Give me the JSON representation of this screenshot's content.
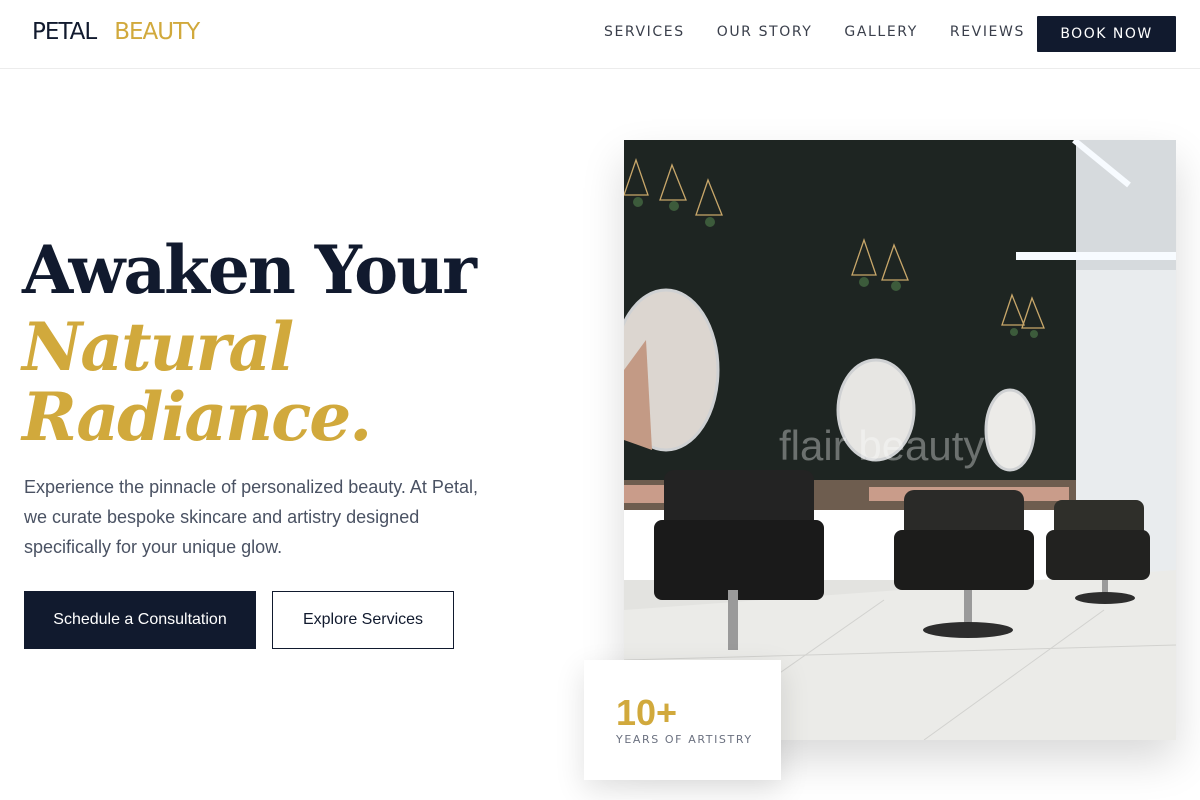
{
  "brand": {
    "word1": "PETAL",
    "word2": "BEAUTY"
  },
  "nav": {
    "items": [
      "SERVICES",
      "OUR STORY",
      "GALLERY",
      "REVIEWS"
    ],
    "cta": "BOOK NOW"
  },
  "hero": {
    "line1": "Awaken Your",
    "line2": "Natural",
    "line3": "Radiance.",
    "description": "Experience the pinnacle of personalized beauty. At Petal, we curate bespoke skincare and artistry designed specifically for your unique glow.",
    "primary_button": "Schedule a Consultation",
    "secondary_button": "Explore Services"
  },
  "photo": {
    "watermark": "flair beauty"
  },
  "stat": {
    "value": "10+",
    "label": "YEARS OF ARTISTRY"
  },
  "colors": {
    "navy": "#111a2e",
    "gold": "#d1a93c"
  }
}
